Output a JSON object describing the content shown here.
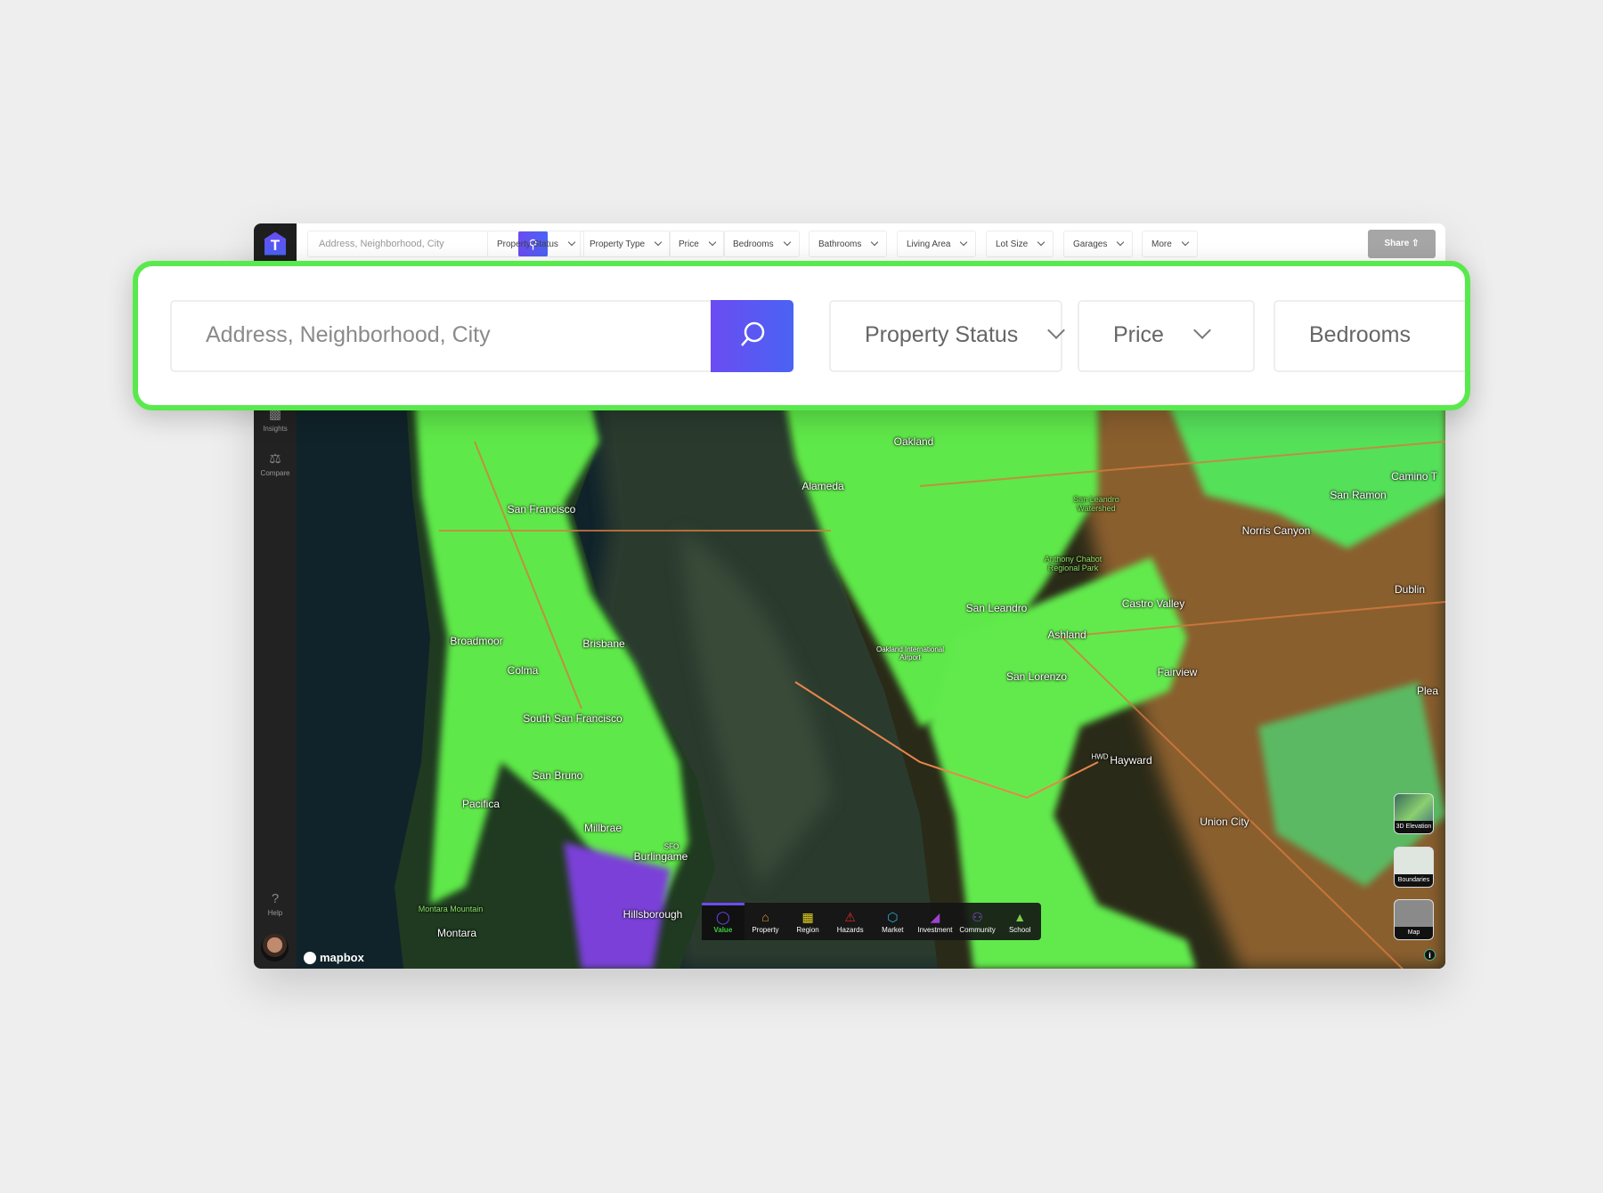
{
  "app": {
    "logo_letter": "T"
  },
  "topbar": {
    "search_placeholder": "Address, Neighborhood, City",
    "filters": [
      "Property Status",
      "Property Type",
      "Price",
      "Bedrooms",
      "Bathrooms",
      "Living Area",
      "Lot Size",
      "Garages",
      "More"
    ],
    "share_label": "Share"
  },
  "sidebar": {
    "items": [
      {
        "label": "Insights",
        "icon": "bar-chart-icon"
      },
      {
        "label": "Compare",
        "icon": "scale-icon"
      }
    ],
    "help_label": "Help"
  },
  "callout": {
    "search_placeholder": "Address, Neighborhood, City",
    "filters": [
      "Property Status",
      "Price",
      "Bedrooms"
    ],
    "highlight_color": "#58ea4c"
  },
  "map": {
    "attribution": "mapbox",
    "labels": {
      "oakland": "Oakland",
      "alameda": "Alameda",
      "san_francisco": "San Francisco",
      "san_leandro": "San Leandro",
      "castro_valley": "Castro Valley",
      "san_ramon": "San Ramon",
      "norris_canyon": "Norris Canyon",
      "dublin": "Dublin",
      "ashland": "Ashland",
      "san_lorenzo": "San Lorenzo",
      "fairview": "Fairview",
      "hayward": "Hayward",
      "union_city": "Union City",
      "broadmoor": "Broadmoor",
      "brisbane": "Brisbane",
      "colma": "Colma",
      "south_san_francisco": "South San Francisco",
      "san_bruno": "San Bruno",
      "pacifica": "Pacifica",
      "millbrae": "Millbrae",
      "burlingame": "Burlingame",
      "hillsborough": "Hillsborough",
      "montara": "Montara",
      "montara_mountain": "Montara Mountain",
      "oakland_airport": "Oakland International Airport",
      "sfo": "SFO",
      "hwd": "HWD",
      "san_leandro_watershed": "San Leandro Watershed",
      "anthony_chabot": "Anthony Chabot Regional Park",
      "camino": "Camino T",
      "plea": "Plea"
    },
    "layer_buttons": [
      "3D Elevation",
      "Boundaries",
      "Map"
    ]
  },
  "toolbar": {
    "active": "Value",
    "items": [
      {
        "label": "Value",
        "icon": "price-tag-icon",
        "color": "#6a4cf2"
      },
      {
        "label": "Property",
        "icon": "house-icon",
        "color": "#e8962e"
      },
      {
        "label": "Region",
        "icon": "grid-icon",
        "color": "#e6d21e"
      },
      {
        "label": "Hazards",
        "icon": "warning-icon",
        "color": "#e02b2b"
      },
      {
        "label": "Market",
        "icon": "hexagon-t-icon",
        "color": "#2bb3d6"
      },
      {
        "label": "Investment",
        "icon": "growth-chart-icon",
        "color": "#a040d0"
      },
      {
        "label": "Community",
        "icon": "people-icon",
        "color": "#8a4ce0"
      },
      {
        "label": "School",
        "icon": "graduation-cap-icon",
        "color": "#7ccf4a"
      }
    ],
    "active_label_color": "#3ccf3c"
  }
}
